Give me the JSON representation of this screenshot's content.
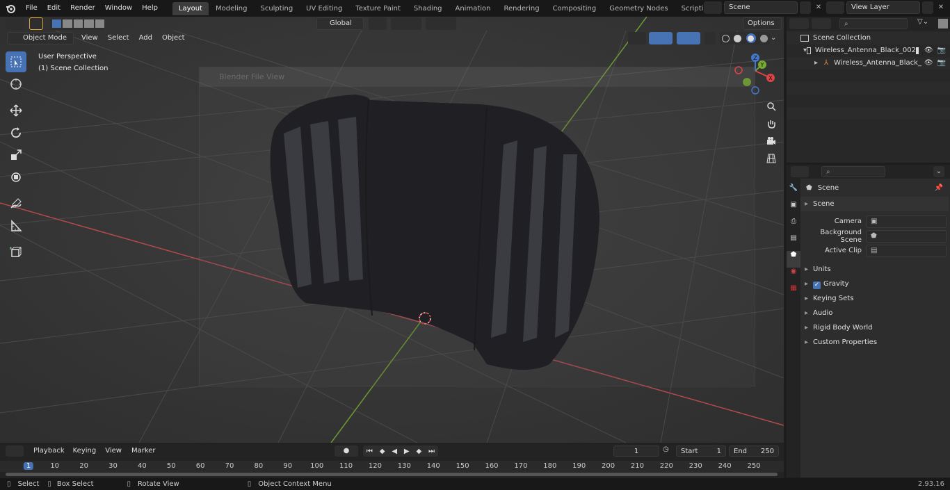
{
  "menubar": {
    "items": [
      "File",
      "Edit",
      "Render",
      "Window",
      "Help"
    ]
  },
  "workspaces": {
    "tabs": [
      "Layout",
      "Modeling",
      "Sculpting",
      "UV Editing",
      "Texture Paint",
      "Shading",
      "Animation",
      "Rendering",
      "Compositing",
      "Geometry Nodes",
      "Scripting"
    ],
    "active": "Layout",
    "add": "+"
  },
  "scene_field": "Scene",
  "view_layer_field": "View Layer",
  "transform": {
    "orientation": "Global",
    "options": "Options"
  },
  "viewport": {
    "mode": "Object Mode",
    "menus": [
      "View",
      "Select",
      "Add",
      "Object"
    ],
    "perspective": "User Perspective",
    "collection": "(1) Scene Collection",
    "ghost_dialog": "Blender File View"
  },
  "gizmo": {
    "x": "X",
    "y": "Y",
    "z": "Z"
  },
  "outliner": {
    "root": "Scene Collection",
    "items": [
      "Wireless_Antenna_Black_002",
      "Wireless_Antenna_Black_"
    ]
  },
  "properties": {
    "title": "Scene",
    "section": "Scene",
    "camera_label": "Camera",
    "background_label": "Background Scene",
    "clip_label": "Active Clip",
    "panels": [
      "Units",
      "Gravity",
      "Keying Sets",
      "Audio",
      "Rigid Body World",
      "Custom Properties"
    ]
  },
  "timeline": {
    "menus": [
      "Playback",
      "Keying",
      "View",
      "Marker"
    ],
    "current_frame": "1",
    "start_label": "Start",
    "start": "1",
    "end_label": "End",
    "end": "250",
    "ticks": [
      "1",
      "10",
      "20",
      "30",
      "40",
      "50",
      "60",
      "70",
      "80",
      "90",
      "100",
      "110",
      "120",
      "130",
      "140",
      "150",
      "160",
      "170",
      "180",
      "190",
      "200",
      "210",
      "220",
      "230",
      "240",
      "250"
    ]
  },
  "statusbar": {
    "select": "Select",
    "box_select": "Box Select",
    "rotate": "Rotate View",
    "context": "Object Context Menu",
    "version": "2.93.16"
  }
}
